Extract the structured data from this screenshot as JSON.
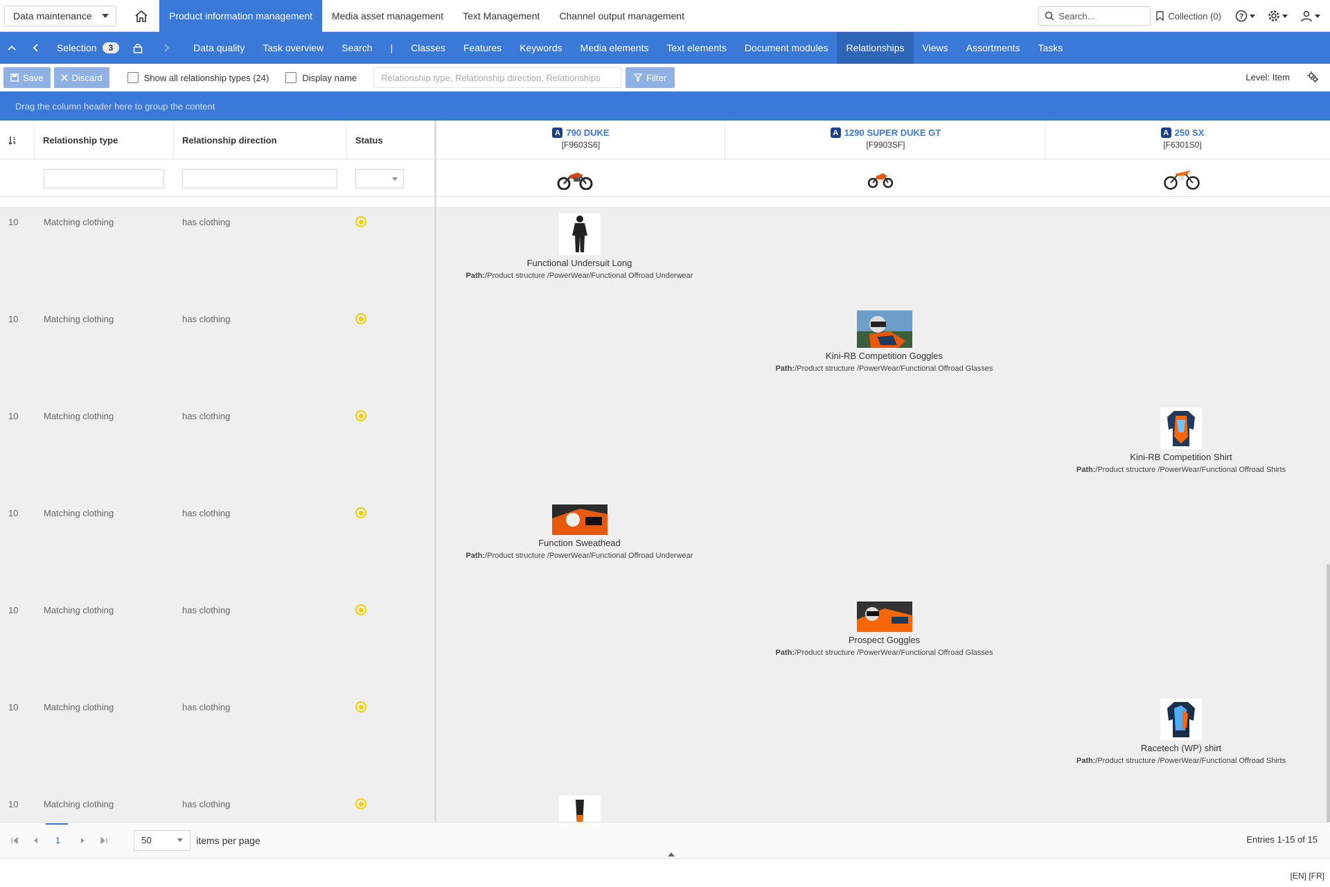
{
  "workspace": {
    "value": "Data maintenance"
  },
  "top_tabs": [
    {
      "label": "Product information management",
      "active": true
    },
    {
      "label": "Media asset management",
      "active": false
    },
    {
      "label": "Text Management",
      "active": false
    },
    {
      "label": "Channel output management",
      "active": false
    }
  ],
  "search": {
    "placeholder": "Search..."
  },
  "collection": {
    "label": "Collection (0)"
  },
  "nav": {
    "selection_label": "Selection",
    "selection_count": "3",
    "separator": "|",
    "items": [
      {
        "label": "Data quality"
      },
      {
        "label": "Task overview"
      },
      {
        "label": "Search"
      },
      {
        "label": "Classes"
      },
      {
        "label": "Features"
      },
      {
        "label": "Keywords"
      },
      {
        "label": "Media elements"
      },
      {
        "label": "Text elements"
      },
      {
        "label": "Document modules"
      },
      {
        "label": "Relationships",
        "active": true
      },
      {
        "label": "Views"
      },
      {
        "label": "Assortments"
      },
      {
        "label": "Tasks"
      }
    ]
  },
  "toolbar": {
    "save_label": "Save",
    "discard_label": "Discard",
    "show_all_label": "Show all relationship types (24)",
    "display_name_label": "Display name",
    "filter_placeholder": "Relationship type, Relationship direction, Relationships",
    "filter_label": "Filter",
    "level_label": "Level: Item"
  },
  "groupbar": {
    "text": "Drag the column header here to group the content"
  },
  "columns": {
    "type": "Relationship type",
    "direction": "Relationship direction",
    "status": "Status"
  },
  "products": [
    {
      "badge": "A",
      "name": "790 DUKE",
      "code": "[F9603S6]"
    },
    {
      "badge": "A",
      "name": "1290 SUPER DUKE GT",
      "code": "[F9903SF]"
    },
    {
      "badge": "A",
      "name": "250 SX",
      "code": "[F6301S0]"
    }
  ],
  "rows": [
    {
      "num": "10",
      "type": "Matching clothing",
      "direction": "has clothing",
      "product_index": 0,
      "item": "Functional Undersuit Long",
      "path_label": "Path:",
      "path": "/Product structure /PowerWear/Functional Offroad Underwear",
      "thumb": "undersuit"
    },
    {
      "num": "10",
      "type": "Matching clothing",
      "direction": "has clothing",
      "product_index": 1,
      "item": "Kini-RB Competition Goggles",
      "path_label": "Path:",
      "path": "/Product structure /PowerWear/Functional Offroad Glasses",
      "thumb": "goggles-photo"
    },
    {
      "num": "10",
      "type": "Matching clothing",
      "direction": "has clothing",
      "product_index": 2,
      "item": "Kini-RB Competition Shirt",
      "path_label": "Path:",
      "path": "/Product structure /PowerWear/Functional Offroad Shirts",
      "thumb": "shirt"
    },
    {
      "num": "10",
      "type": "Matching clothing",
      "direction": "has clothing",
      "product_index": 0,
      "item": "Function Sweathead",
      "path_label": "Path:",
      "path": "/Product structure /PowerWear/Functional Offroad Underwear",
      "thumb": "sweathead-photo"
    },
    {
      "num": "10",
      "type": "Matching clothing",
      "direction": "has clothing",
      "product_index": 1,
      "item": "Prospect Goggles",
      "path_label": "Path:",
      "path": "/Product structure /PowerWear/Functional Offroad Glasses",
      "thumb": "goggles-photo-2"
    },
    {
      "num": "10",
      "type": "Matching clothing",
      "direction": "has clothing",
      "product_index": 2,
      "item": "Racetech (WP) shirt",
      "path_label": "Path:",
      "path": "/Product structure /PowerWear/Functional Offroad Shirts",
      "thumb": "shirt-2"
    },
    {
      "num": "10",
      "type": "Matching clothing",
      "direction": "has clothing",
      "product_index": 0,
      "item": "",
      "path_label": "",
      "path": "",
      "thumb": "pants"
    }
  ],
  "pager": {
    "page": "1",
    "per_page": "50",
    "per_page_label": "items per page",
    "entries": "Entries 1-15 of 15"
  },
  "languages": "[EN] [FR]",
  "colors": {
    "accent": "#3b79d8",
    "status": "#f0d000",
    "badge": "#1b3f8a"
  }
}
